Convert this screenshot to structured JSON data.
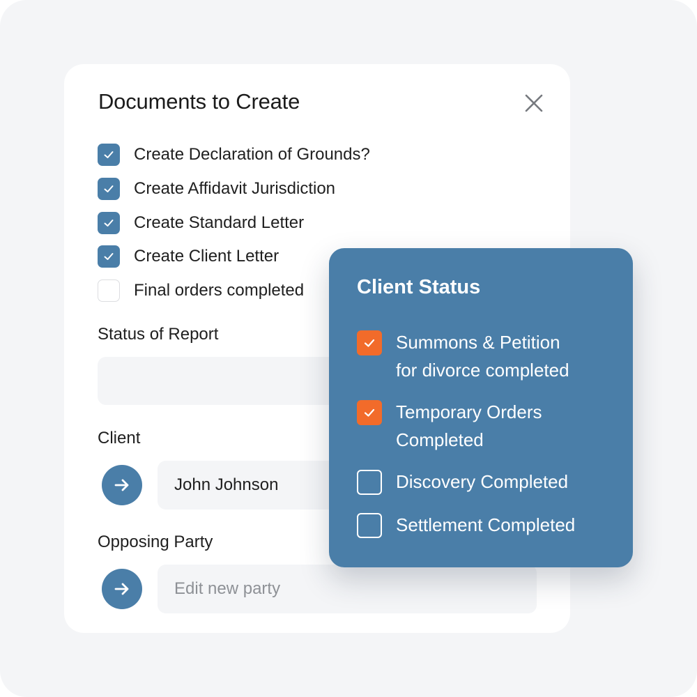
{
  "documents_panel": {
    "title": "Documents to Create",
    "items": [
      {
        "label": "Create Declaration of Grounds?",
        "checked": true
      },
      {
        "label": "Create Affidavit Jurisdiction",
        "checked": true
      },
      {
        "label": "Create Standard Letter",
        "checked": true
      },
      {
        "label": "Create Client Letter",
        "checked": true
      },
      {
        "label": "Final orders completed",
        "checked": false
      }
    ],
    "status_label": "Status of Report",
    "status_value": "",
    "client_label": "Client",
    "client_value": "John Johnson",
    "opposing_label": "Opposing Party",
    "opposing_placeholder": "Edit new party"
  },
  "client_status": {
    "title": "Client Status",
    "items": [
      {
        "line1": "Summons & Petition",
        "line2": "for divorce completed",
        "checked": true
      },
      {
        "line1": "Temporary Orders",
        "line2": "Completed",
        "checked": true
      },
      {
        "line1": "Discovery Completed",
        "line2": "",
        "checked": false
      },
      {
        "line1": "Settlement Completed",
        "line2": "",
        "checked": false
      }
    ]
  },
  "colors": {
    "accent_blue": "#4a7ea8",
    "accent_orange": "#f26b2a",
    "background": "#f4f5f7"
  },
  "icons": {
    "close": "close-icon",
    "arrow": "arrow-right-icon",
    "check": "check-icon"
  }
}
